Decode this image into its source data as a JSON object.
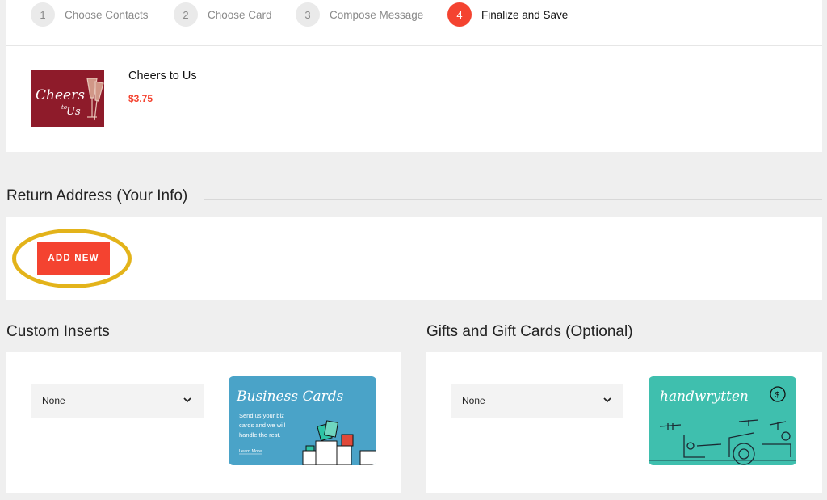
{
  "steps": [
    {
      "num": "1",
      "label": "Choose Contacts"
    },
    {
      "num": "2",
      "label": "Choose Card"
    },
    {
      "num": "3",
      "label": "Compose Message"
    },
    {
      "num": "4",
      "label": "Finalize and Save"
    }
  ],
  "product": {
    "title": "Cheers to Us",
    "price": "$3.75",
    "thumb_text_main": "Cheers",
    "thumb_text_small": "to",
    "thumb_text_end": "Us"
  },
  "return_address": {
    "heading": "Return Address (Your Info)",
    "add_new_label": "ADD NEW"
  },
  "custom_inserts": {
    "heading": "Custom Inserts",
    "select_value": "None",
    "promo": {
      "title": "Business Cards",
      "body_line1": "Send us your biz",
      "body_line2": "cards and we will",
      "body_line3": "handle the rest.",
      "link": "Learn More"
    }
  },
  "gifts": {
    "heading": "Gifts and Gift Cards (Optional)",
    "select_value": "None",
    "promo": {
      "brand": "handwrytten",
      "dollar": "$"
    }
  },
  "colors": {
    "accent": "#f44330",
    "highlight": "#e3b31a",
    "business_card_bg": "#4aa3c8",
    "gift_card_bg": "#3fbfae"
  }
}
